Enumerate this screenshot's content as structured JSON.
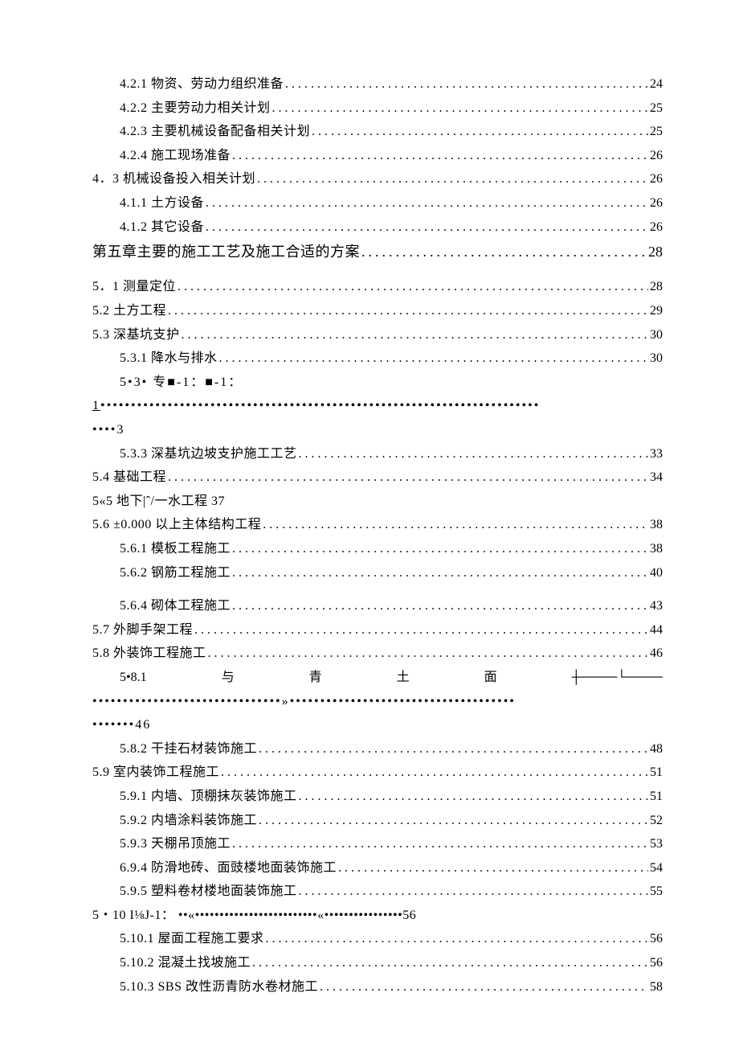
{
  "entries": [
    {
      "id": "e1",
      "cls": "indent1",
      "label": "4.2.1 物资、劳动力组织准备",
      "page": "24"
    },
    {
      "id": "e2",
      "cls": "indent1",
      "label": "4.2.2 主要劳动力相关计划",
      "page": "25"
    },
    {
      "id": "e3",
      "cls": "indent1",
      "label": "4.2.3 主要机械设备配备相关计划",
      "page": "25"
    },
    {
      "id": "e4",
      "cls": "indent1",
      "label": "4.2.4 施工现场准备",
      "page": "26"
    },
    {
      "id": "e5",
      "cls": "",
      "label": "4．3 机械设备投入相关计划",
      "page": "26"
    },
    {
      "id": "e6",
      "cls": "indent1",
      "label": "4.1.1 土方设备",
      "page": "26"
    },
    {
      "id": "e7",
      "cls": "indent1",
      "label": "4.1.2 其它设备",
      "page": "26"
    },
    {
      "id": "e8",
      "cls": "chapter",
      "label": "第五章主要的施工工艺及施工合适的方案",
      "page": "28"
    },
    {
      "id": "e9",
      "cls": "extra-gap",
      "label": "5．1 测量定位",
      "page": "28"
    },
    {
      "id": "e10",
      "cls": "",
      "label": "5.2 土方工程",
      "page": "29"
    },
    {
      "id": "e11",
      "cls": "",
      "label": "5.3 深基坑支护",
      "page": "30"
    },
    {
      "id": "e12",
      "cls": "indent1",
      "label": "5.3.1 降水与排水",
      "page": "30"
    }
  ],
  "garble1_line1_prefix": "5•3•    专■-1：■-1：",
  "garble1_line2_frag": "1",
  "garble1_line3": "••••3",
  "entries2": [
    {
      "id": "f1",
      "cls": "indent1",
      "label": "5.3.3 深基坑边坡支护施工工艺",
      "page": "33"
    },
    {
      "id": "f2",
      "cls": "",
      "label": "5.4 基础工程",
      "page": "34"
    }
  ],
  "noLeader1": {
    "id": "nl1",
    "label": "5«5 地下|ˆ/一水工程 37"
  },
  "entries3": [
    {
      "id": "g1",
      "cls": "",
      "label": "5.6 ±0.000 以上主体结构工程",
      "page": "38"
    },
    {
      "id": "g2",
      "cls": "indent1",
      "label": "5.6.1 模板工程施工",
      "page": "38"
    },
    {
      "id": "g3",
      "cls": "indent1",
      "label": "5.6.2 钢筋工程施工",
      "page": "40"
    },
    {
      "id": "g4",
      "cls": "indent1 extra-gap",
      "label": "5.6.4 砌体工程施工",
      "page": "43"
    },
    {
      "id": "g5",
      "cls": "",
      "label": "5.7 外脚手架工程",
      "page": "44"
    },
    {
      "id": "g6",
      "cls": "",
      "label": "5.8  外装饰工程施工",
      "page": "46"
    }
  ],
  "spread581": {
    "parts": [
      "5•8.1",
      "与",
      "青",
      "土",
      "面",
      "┼────└────"
    ]
  },
  "garble2_line1": "•••••••••••••••••••••••••••••••»•••••••••••••••••••••••••••••••••••••",
  "garble2_line2": "•••••••46",
  "entries4": [
    {
      "id": "h1",
      "cls": "indent1",
      "label": "5.8.2 干挂石材装饰施工",
      "page": "48"
    },
    {
      "id": "h2",
      "cls": "",
      "label": "5.9  室内装饰工程施工",
      "page": "51"
    },
    {
      "id": "h3",
      "cls": "indent1",
      "label": "5.9.1 内墙、顶棚抹灰装饰施工",
      "page": "51"
    },
    {
      "id": "h4",
      "cls": "indent1",
      "label": "5.9.2 内墙涂料装饰施工",
      "page": "52"
    },
    {
      "id": "h5",
      "cls": "indent1",
      "label": "5.9.3 天棚吊顶施工",
      "page": "53"
    },
    {
      "id": "h6",
      "cls": "indent1",
      "label": "6.9.4 防滑地砖、面豉楼地面装饰施工",
      "page": "54"
    },
    {
      "id": "h7",
      "cls": "indent1",
      "label": "5.9.5 塑料卷材楼地面装饰施工",
      "page": "55"
    }
  ],
  "garble3": {
    "label": "5・10   I⅛J-1：   ••«•••••••••••••••••••••••••«••••••••••••••••56"
  },
  "entries5": [
    {
      "id": "k1",
      "cls": "indent1",
      "label": "5.10.1 屋面工程施工要求",
      "page": "56"
    },
    {
      "id": "k2",
      "cls": "indent1",
      "label": "5.10.2 混凝土找坡施工",
      "page": "56"
    },
    {
      "id": "k3",
      "cls": "indent1",
      "label": "5.10.3 SBS 改性沥青防水卷材施工",
      "page": "58"
    }
  ],
  "leader": "...................................................................................."
}
